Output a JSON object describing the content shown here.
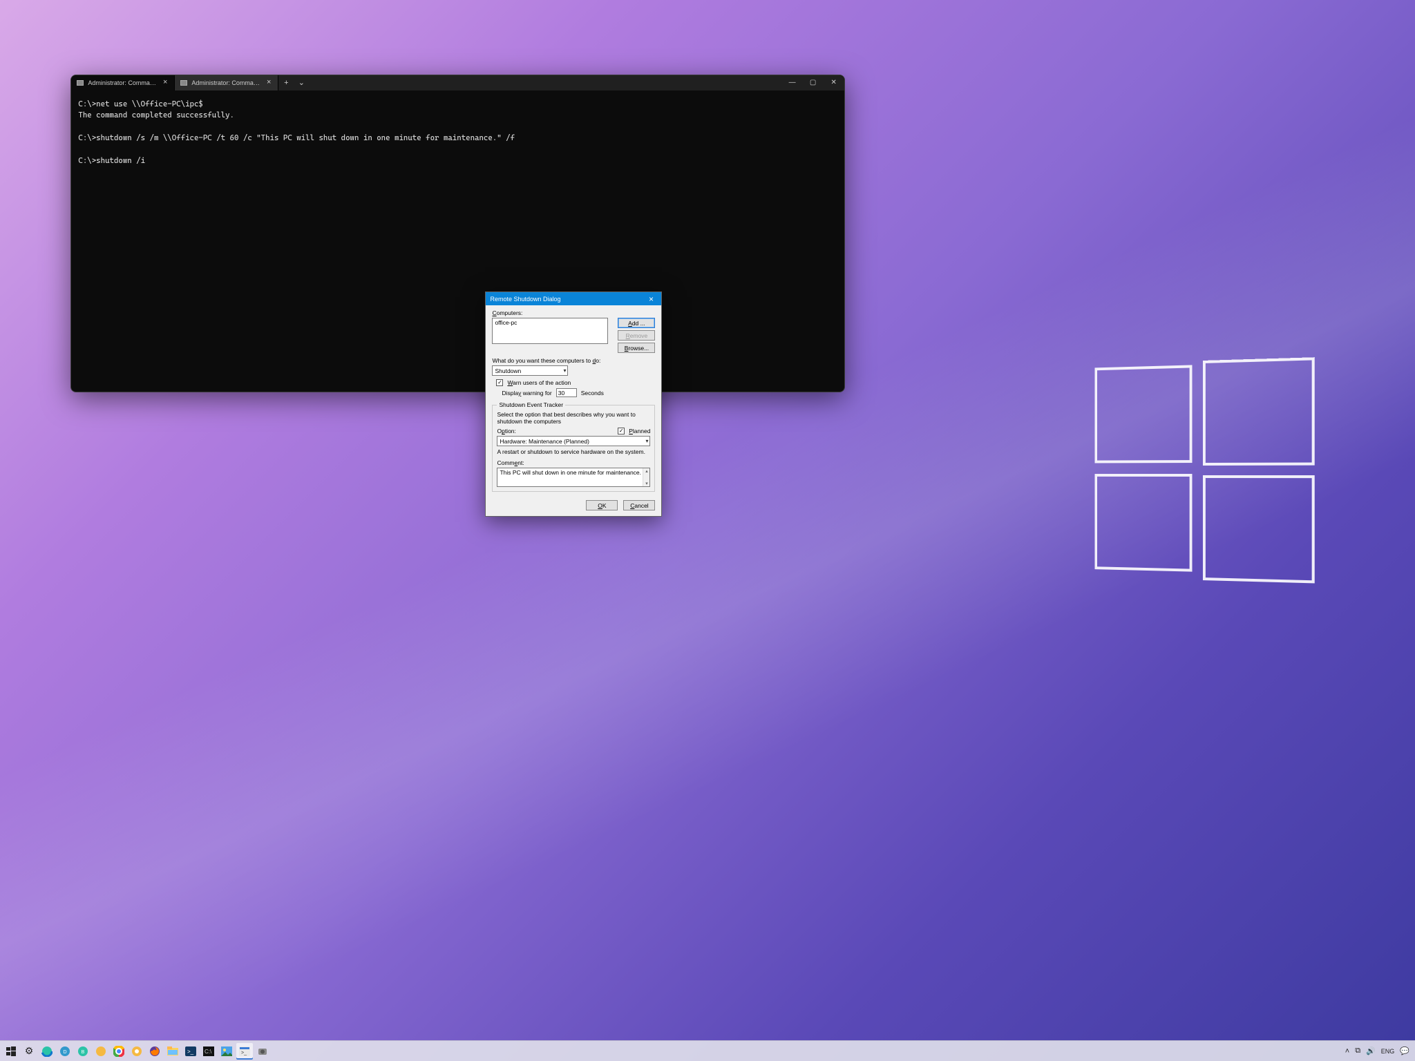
{
  "terminal": {
    "tabs": [
      {
        "title": "Administrator: Command Prom…"
      },
      {
        "title": "Administrator: Command Prom…"
      }
    ],
    "lines": {
      "l1": "C:\\>net use \\\\Office-PC\\ipc$",
      "l2": "The command completed successfully.",
      "l3": "",
      "l4": "C:\\>shutdown /s /m \\\\Office-PC /t 60 /c \"This PC will shut down in one minute for maintenance.\" /f",
      "l5": "",
      "l6": "C:\\>shutdown /i"
    }
  },
  "dialog": {
    "title": "Remote Shutdown Dialog",
    "computers_label": "Computers:",
    "computers_value": "office-pc",
    "buttons": {
      "add": "Add ...",
      "remove": "Remove",
      "browse": "Browse..."
    },
    "action_label": "What do you want these computers to do:",
    "action_value": "Shutdown",
    "warn_label": "Warn users of the action",
    "warn_checked": true,
    "display_warning_label": "Display warning for",
    "seconds_value": "30",
    "seconds_label": "Seconds",
    "tracker_legend": "Shutdown Event Tracker",
    "tracker_desc": "Select the option that best describes why you want to shutdown the computers",
    "option_label": "Option:",
    "planned_label": "Planned",
    "planned_checked": true,
    "option_value": "Hardware: Maintenance (Planned)",
    "option_desc": "A restart or shutdown to service hardware on the system.",
    "comment_label": "Comment:",
    "comment_value": "This PC will shut down in one minute for maintenance.",
    "ok": "OK",
    "cancel": "Cancel"
  },
  "taskbar": {
    "tray": {
      "lang": "ENG"
    }
  }
}
